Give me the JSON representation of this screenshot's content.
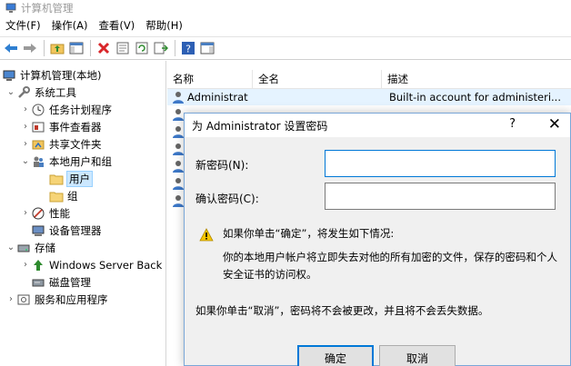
{
  "window": {
    "title": "计算机管理"
  },
  "menu": [
    {
      "label": "文件(F)"
    },
    {
      "label": "操作(A)"
    },
    {
      "label": "查看(V)"
    },
    {
      "label": "帮助(H)"
    }
  ],
  "tree": {
    "root": "计算机管理(本地)",
    "system_tools": "系统工具",
    "task_scheduler": "任务计划程序",
    "event_viewer": "事件查看器",
    "shared_folders": "共享文件夹",
    "local_users_groups": "本地用户和组",
    "users": "用户",
    "groups": "组",
    "performance": "性能",
    "device_manager": "设备管理器",
    "storage": "存储",
    "windows_server_backup": "Windows Server Back",
    "disk_management": "磁盘管理",
    "services_apps": "服务和应用程序"
  },
  "list": {
    "columns": {
      "name": "名称",
      "fullname": "全名",
      "description": "描述"
    },
    "rows": [
      {
        "name": "Administrat",
        "fullname": "",
        "description": "Built-in account for administeri..."
      }
    ]
  },
  "dialog": {
    "title": "为 Administrator 设置密码",
    "help": "?",
    "close": "✕",
    "new_password_label": "新密码(N):",
    "confirm_password_label": "确认密码(C):",
    "new_password_value": "",
    "confirm_password_value": "",
    "warning_heading": "如果你单击“确定”，将发生如下情况:",
    "warning_body_1": "你的本地用户帐户将立即失去对他的所有加密的文件，保存的密码和个人",
    "warning_body_2": "安全证书的访问权。",
    "cancel_note": "如果你单击“取消”，密码将不会被更改，并且将不会丢失数据。",
    "ok": "确定",
    "cancel": "取消"
  },
  "colors": {
    "accent": "#0078d7",
    "selection": "#cce8ff",
    "dialog_bg": "#f0f0f0"
  }
}
